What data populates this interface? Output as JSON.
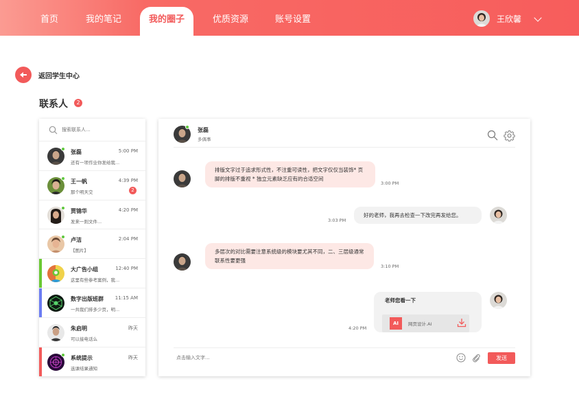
{
  "nav": {
    "items": [
      {
        "label": "首页"
      },
      {
        "label": "我的笔记"
      },
      {
        "label": "我的圈子"
      },
      {
        "label": "优质资源"
      },
      {
        "label": "账号设置"
      }
    ],
    "active_index": 2,
    "user_name": "王欣馨"
  },
  "back_label": "返回学生中心",
  "contacts": {
    "title": "联系人",
    "badge": "2",
    "search_placeholder": "搜索联系人...",
    "items": [
      {
        "name": "张磊",
        "time": "5:00 PM",
        "message": "还有一项作业你发给我...",
        "online": true
      },
      {
        "name": "王一帆",
        "time": "4:39 PM",
        "message": "那个明天交",
        "online": true,
        "badge": "2"
      },
      {
        "name": "贾锦华",
        "time": "4:20 PM",
        "message": "发来一则文件...",
        "online": true
      },
      {
        "name": "卢洁",
        "time": "2:04 PM",
        "message": "【图片】",
        "online": true
      },
      {
        "name": "大广告小组",
        "time": "12:40 PM",
        "message": "这里有些参考案例，我...",
        "accent": "#6ac833"
      },
      {
        "name": "数字出版班群",
        "time": "11:15 AM",
        "message": "一共我们排多少页，明...",
        "accent": "#6b7cf2"
      },
      {
        "name": "朱启明",
        "time": "昨天",
        "message": "可以接电话么"
      },
      {
        "name": "系统提示",
        "time": "昨天",
        "message": "选课结果通知",
        "online": true,
        "accent": "#f25a5a"
      }
    ]
  },
  "chat": {
    "name": "张磊",
    "role": "多偶事",
    "messages": [
      {
        "direction": "in",
        "text": "排版文字过于追求形式性，不注重可读性，把文字仅仅当装饰* 页脚的排版不重视 * 独立元素缺乏应有的合适空间",
        "time": "3:00 PM"
      },
      {
        "direction": "out",
        "text": "好的老师，我再去检查一下改完再发给您。",
        "time": "3:03 PM"
      },
      {
        "direction": "in",
        "text": "多层次的对比需要注意系统级的模块要尤其不同，二、三层级通常联系性要更强",
        "time": "3:10 PM"
      },
      {
        "direction": "out",
        "text": "老师您看一下",
        "time": "4:20 PM",
        "file": {
          "type_label": "AI",
          "name": "网页设计.AI"
        }
      }
    ],
    "input_placeholder": "点击输入文字...",
    "send_label": "发送"
  },
  "colors": {
    "accent": "#f25a5a",
    "online": "#5fc73d",
    "bubble_in": "#fde8e5",
    "bubble_out": "#f2f2f2"
  }
}
